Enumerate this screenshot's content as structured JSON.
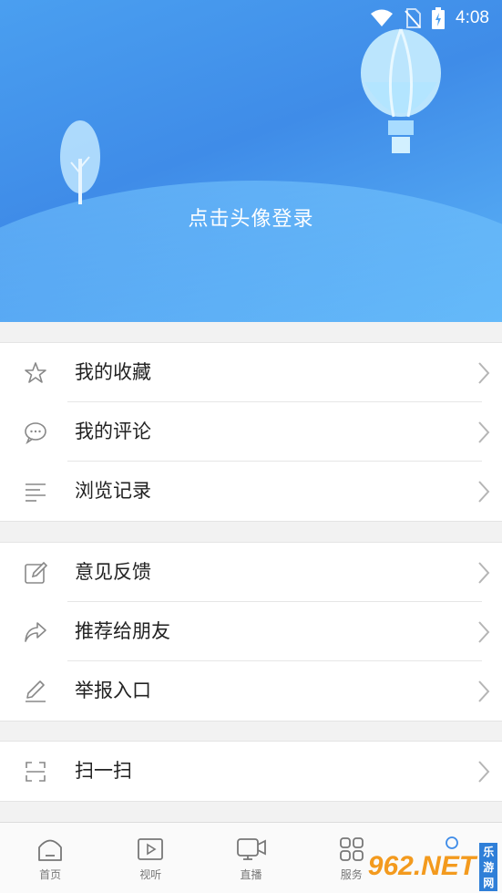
{
  "status_bar": {
    "time": "4:08"
  },
  "header": {
    "login_prompt": "点击头像登录"
  },
  "menu_groups": [
    {
      "items": [
        {
          "label": "我的收藏",
          "icon": "star-icon"
        },
        {
          "label": "我的评论",
          "icon": "comment-icon"
        },
        {
          "label": "浏览记录",
          "icon": "history-lines-icon"
        }
      ]
    },
    {
      "items": [
        {
          "label": "意见反馈",
          "icon": "edit-square-icon"
        },
        {
          "label": "推荐给朋友",
          "icon": "share-arrow-icon"
        },
        {
          "label": "举报入口",
          "icon": "pencil-icon"
        }
      ]
    },
    {
      "items": [
        {
          "label": "扫一扫",
          "icon": "scan-icon"
        }
      ]
    }
  ],
  "bottom_nav": [
    {
      "label": "首页",
      "icon": "home-icon"
    },
    {
      "label": "视听",
      "icon": "video-play-icon"
    },
    {
      "label": "直播",
      "icon": "live-camera-icon"
    },
    {
      "label": "服务",
      "icon": "grid-icon"
    },
    {
      "label": "",
      "icon": "profile-icon"
    }
  ],
  "watermark": {
    "main": "962.NET",
    "sub": "乐游网"
  },
  "colors": {
    "header_start": "#4a9ff0",
    "header_end": "#5cb4f7",
    "watermark": "#f39a1e"
  }
}
